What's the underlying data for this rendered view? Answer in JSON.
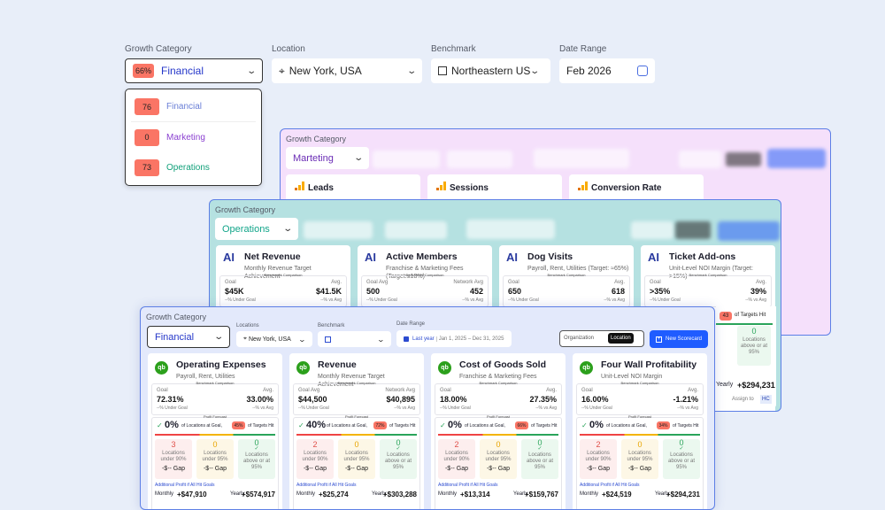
{
  "filters": {
    "growth_category_label": "Growth Category",
    "growth_category_badge": "66%",
    "growth_category_value": "Financial",
    "location_label": "Location",
    "location_value": "New York, USA",
    "benchmark_label": "Benchmark",
    "benchmark_value": "Northeastern US",
    "date_range_label": "Date Range",
    "date_range_value": "Feb 2026"
  },
  "dropdown": [
    {
      "count": "76",
      "label": "Financial",
      "color": "#6a7fd6"
    },
    {
      "count": "0",
      "label": "Marketing",
      "color": "#8a3fd0"
    },
    {
      "count": "73",
      "label": "Operations",
      "color": "#11a07a"
    }
  ],
  "marketing_panel": {
    "growth_category_label": "Growth Category",
    "category": "Marteting",
    "cards": [
      {
        "title": "Leads"
      },
      {
        "title": "Sessions"
      },
      {
        "title": "Conversion Rate"
      }
    ]
  },
  "operations_panel": {
    "growth_category_label": "Growth Category",
    "category": "Operations",
    "cards": [
      {
        "icon": "AI",
        "title": "Net Revenue",
        "subtitle": "Monthly Revenue Target Achievement",
        "benchmark_label": "Benchmark Comparison",
        "goal_label": "Goal",
        "goal": "$45K",
        "goal_note": "--% Under Goal",
        "avg_label": "Avg.",
        "avg": "$41.5K",
        "avg_note": "--% vs Avg"
      },
      {
        "icon": "AI",
        "title": "Active Members",
        "subtitle": "Franchise & Marketing Fees (Target:≤18%)",
        "benchmark_label": "Benchmark Comparison",
        "goal_label": "Goal Avg",
        "goal": "500",
        "goal_note": "--% Under Goal",
        "avg_label": "Network Avg",
        "avg": "452",
        "avg_note": "--% vs Avg"
      },
      {
        "icon": "AI",
        "title": "Dog Visits",
        "subtitle": "Payroll, Rent, Utilities (Target: ≈65%)",
        "benchmark_label": "Benchmark Comparison",
        "goal_label": "Goal",
        "goal": "650",
        "goal_note": "--% Under Goal",
        "avg_label": "Avg.",
        "avg": "618",
        "avg_note": "--% vs Avg"
      },
      {
        "icon": "AI",
        "title": "Ticket Add-ons",
        "subtitle": "Unit-Level NOI Margin (Target: >15%)",
        "benchmark_label": "Benchmark Comparison",
        "goal_label": "Goal",
        "goal": ">35%",
        "goal_note": "--% Under Goal",
        "avg_label": "Avg.",
        "avg": "39%",
        "avg_note": "--% vs Avg"
      }
    ],
    "peek": {
      "badge": "43",
      "targets": "of Targets Hit",
      "count": "0",
      "tile_text": "Locations above or at 95%",
      "yearly_label": "Yearly",
      "yearly": "+$294,231",
      "assign_label": "Assign to",
      "assignee": "HC"
    }
  },
  "financial_panel": {
    "growth_category_label": "Growth Category",
    "category": "Financial",
    "locations_label": "Locations",
    "location": "New York, USA",
    "benchmark_label": "Benchmark",
    "date_range_label": "Date Range",
    "date_preset": "Last year",
    "date_range": "Jan 1, 2025 – Dec 31, 2025",
    "toggle_org": "Organization",
    "toggle_loc": "Location",
    "new_scorecard": "New Scorecard",
    "cards": [
      {
        "icon": "qb",
        "title": "Operating Expenses",
        "subtitle": "Payroll, Rent, Utilities",
        "benchmark_label": "Benchmark Comparison",
        "goal_label": "Goal",
        "goal": "72.31%",
        "goal_note": "--% Under Goal",
        "avg_label": "Avg.",
        "avg": "33.00%",
        "avg_note": "--% vs Avg",
        "forecast_label": "Profit Forecast",
        "pct": "0%",
        "at_goal": "of Locations at Goal,",
        "badge": "45%",
        "targets": "of Targets Hit",
        "red": "3",
        "red_text": "Locations under 90%",
        "red_gap": "-$-- Gap",
        "yellow": "0",
        "yellow_text": "Locations under 95%",
        "yellow_gap": "-$-- Gap",
        "green": "0",
        "green_text": "Locations above or at 95%",
        "additional": "Additional Profit if All Hit Goals",
        "monthly_label": "Monthly",
        "monthly": "+$47,910",
        "yearly_label": "Yearly",
        "yearly": "+$574,917"
      },
      {
        "icon": "qb",
        "title": "Revenue",
        "subtitle": "Monthly Revenue Target Achievement",
        "benchmark_label": "Benchmark Comparison",
        "goal_label": "Goal Avg",
        "goal": "$44,500",
        "goal_note": "--% Under Goal",
        "avg_label": "Network Avg",
        "avg": "$40,895",
        "avg_note": "--% vs Avg",
        "forecast_label": "Profit Forecast",
        "pct": "40%",
        "at_goal": "of Locations at Goal,",
        "badge": "72%",
        "targets": "of Targets Hit",
        "red": "2",
        "red_text": "Locations under 90%",
        "red_gap": "-$-- Gap",
        "yellow": "0",
        "yellow_text": "Locations under 95%",
        "yellow_gap": "-$-- Gap",
        "green": "0",
        "green_text": "Locations above or at 95%",
        "additional": "Additional Profit if All Hit Goals",
        "monthly_label": "Monthly",
        "monthly": "+$25,274",
        "yearly_label": "Yearly",
        "yearly": "+$303,288"
      },
      {
        "icon": "qb",
        "title": "Cost of Goods Sold",
        "subtitle": "Franchise & Marketing Fees",
        "benchmark_label": "Benchmark Comparison",
        "goal_label": "Goal",
        "goal": "18.00%",
        "goal_note": "--% Under Goal",
        "avg_label": "Avg.",
        "avg": "27.35%",
        "avg_note": "--% vs Avg",
        "forecast_label": "Profit Forecast",
        "pct": "0%",
        "at_goal": "of Locations at Goal,",
        "badge": "66%",
        "targets": "of Targets Hit",
        "red": "2",
        "red_text": "Locations under 90%",
        "red_gap": "-$-- Gap",
        "yellow": "0",
        "yellow_text": "Locations under 95%",
        "yellow_gap": "-$-- Gap",
        "green": "0",
        "green_text": "Locations above or at 95%",
        "additional": "Additional Profit if All Hit Goals",
        "monthly_label": "Monthly",
        "monthly": "+$13,314",
        "yearly_label": "Yearly",
        "yearly": "+$159,767"
      },
      {
        "icon": "qb",
        "title": "Four Wall Profitability",
        "subtitle": "Unit-Level NOI Margin",
        "benchmark_label": "Benchmark Comparison",
        "goal_label": "Goal",
        "goal": "16.00%",
        "goal_note": "--% Under Goal",
        "avg_label": "Avg.",
        "avg": "-1.21%",
        "avg_note": "--% vs Avg",
        "forecast_label": "Profit Forecast",
        "pct": "0%",
        "at_goal": "of Locations at Goal,",
        "badge": "34%",
        "targets": "of Targets Hit",
        "red": "2",
        "red_text": "Locations under 90%",
        "red_gap": "-$-- Gap",
        "yellow": "0",
        "yellow_text": "Locations under 95%",
        "yellow_gap": "-$-- Gap",
        "green": "0",
        "green_text": "Locations above or at 95%",
        "additional": "Additional Profit if All Hit Goals",
        "monthly_label": "Monthly",
        "monthly": "+$24,519",
        "yearly_label": "Yearly",
        "yearly": "+$294,231"
      }
    ]
  },
  "colors": {
    "accent": "#1f5cff",
    "badge": "#fa7565",
    "marketing_bg": "#f5e0fb",
    "operations_bg": "#b5e1e1",
    "financial_bg": "#e3e9fb"
  }
}
